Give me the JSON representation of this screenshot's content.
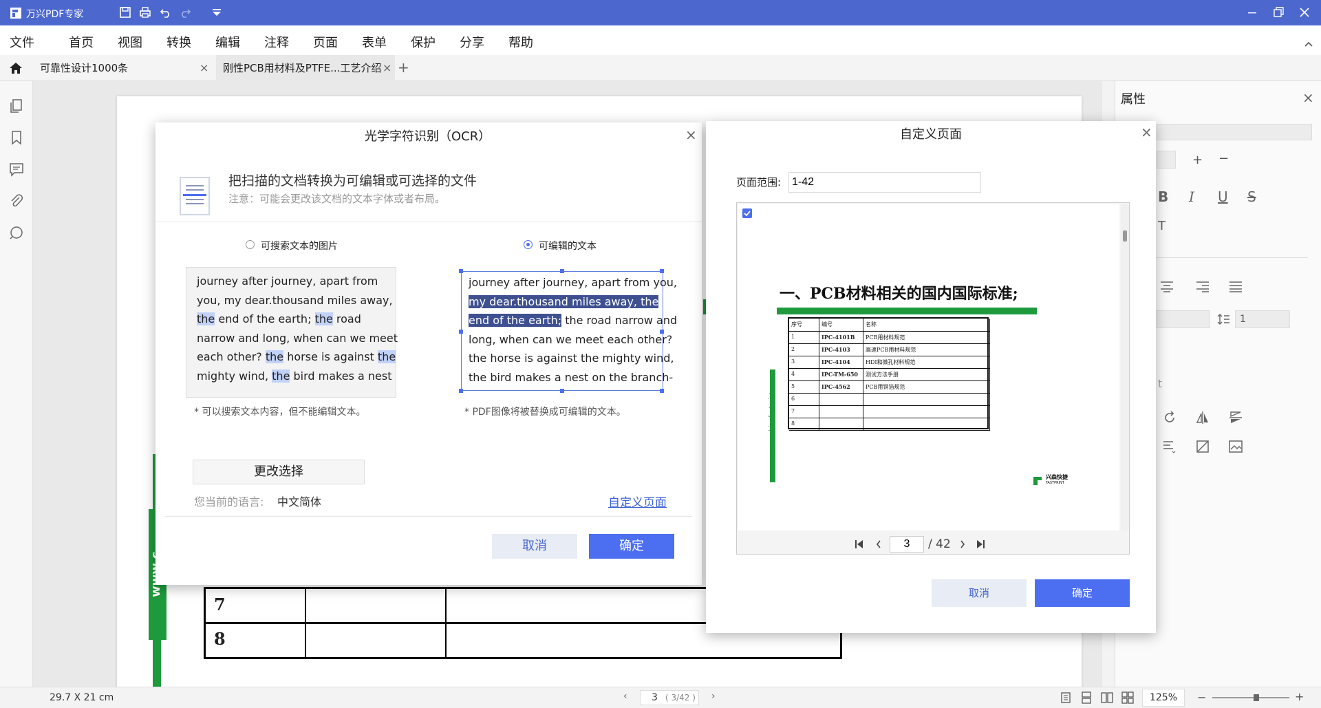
{
  "app": {
    "name": "万兴PDF专家"
  },
  "menu": [
    "文件",
    "首页",
    "视图",
    "转换",
    "编辑",
    "注释",
    "页面",
    "表单",
    "保护",
    "分享",
    "帮助"
  ],
  "tabs": [
    {
      "label": "可靠性设计1000条",
      "close": "×"
    },
    {
      "label": "刚性PCB用材料及PTFE...工艺介绍",
      "close": "×"
    }
  ],
  "add_tab": "+",
  "ocr_dialog": {
    "title": "光学字符识别（OCR）",
    "close": "×",
    "heading": "把扫描的文档转换为可编辑或可选择的文件",
    "note": "注意：可能会更改该文档的文本字体或者布局。",
    "options": [
      {
        "label": "可搜索文本的图片",
        "selected": false
      },
      {
        "label": "可编辑的文本",
        "selected": true
      }
    ],
    "sample_left": [
      [
        "journey after journey, apart from"
      ],
      [
        "you, my dear.thousand miles away,"
      ],
      [
        {
          "hl": "the"
        },
        " end of the earth; ",
        {
          "hl": "the"
        },
        " road"
      ],
      [
        "narrow and long, when can we meet"
      ],
      [
        "each other? ",
        {
          "hl": "the"
        },
        " horse is against ",
        {
          "hl": "the"
        }
      ],
      [
        "mighty wind, ",
        {
          "hl": "the"
        },
        " bird makes a nest"
      ]
    ],
    "sample_right": [
      [
        "journey after journey, apart from you,"
      ],
      [
        {
          "sel": "my dear.thousand miles away, the"
        }
      ],
      [
        {
          "sel": "end of the earth;"
        },
        " the road narrow and"
      ],
      [
        "long, when can we meet each other?"
      ],
      [
        "the horse is against the mighty wind,"
      ],
      [
        "the bird makes a nest on the branch-"
      ]
    ],
    "caption_left": "* 可以搜索文本内容，但不能编辑文本。",
    "caption_right": "* PDF图像将被替换成可编辑的文本。",
    "change_button": "更改选择",
    "language_label": "您当前的语言:",
    "language_value": "中文简体",
    "custom_page_link": "自定义页面",
    "cancel": "取消",
    "ok": "确定"
  },
  "custom_dialog": {
    "title": "自定义页面",
    "close": "×",
    "range_label": "页面范围:",
    "range_value": "1-42",
    "checked": true,
    "preview": {
      "heading": "一、PCB材料相关的国内国际标准;",
      "columns": [
        "序号",
        "编号",
        "名称"
      ],
      "rows": [
        [
          "1",
          "IPC-4101B",
          "PCB用材料规范"
        ],
        [
          "2",
          "IPC-4103",
          "高速PCB用材料规范"
        ],
        [
          "3",
          "IPC-4104",
          "HDI和微孔材料规范"
        ],
        [
          "4",
          "IPC-TM-650",
          "测试方法手册"
        ],
        [
          "5",
          "IPC-4562",
          "PCB用铜箔规范"
        ],
        [
          "6",
          "",
          ""
        ],
        [
          "7",
          "",
          ""
        ],
        [
          "8",
          "",
          ""
        ]
      ],
      "side_url": "www.chinafastprint.com",
      "logo_cn": "兴森快捷",
      "logo_en": "FASTPRINT"
    },
    "pager_current": "3",
    "pager_total": "/ 42",
    "cancel": "取消",
    "ok": "确定"
  },
  "doc_table": {
    "rows": [
      [
        "7",
        "",
        ""
      ],
      [
        "8",
        "",
        ""
      ]
    ],
    "side_url": "www.c"
  },
  "right_panel": {
    "title": "属性",
    "close": "×",
    "line_spacing": "1",
    "partial_t": "t"
  },
  "status": {
    "page_size": "29.7 X 21 cm",
    "page_current": "3",
    "page_of": "( 3/42 )",
    "zoom": "125%",
    "zoom_minus": "−",
    "zoom_plus": "+"
  },
  "colors": {
    "brand": "#4c68cf",
    "primary_button": "#4c6ef0",
    "accent_green": "#1e9a3c"
  }
}
